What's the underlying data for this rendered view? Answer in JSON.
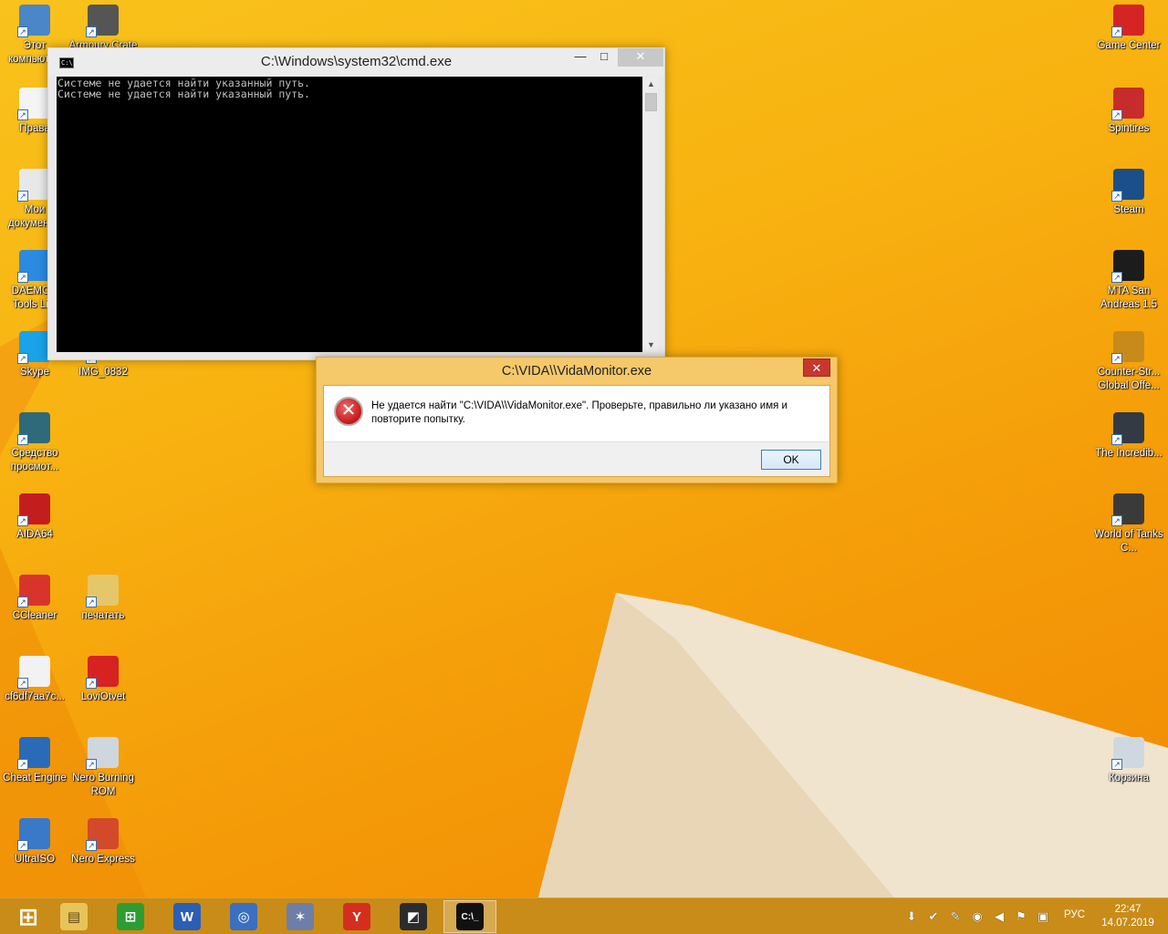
{
  "cmd_window": {
    "title": "C:\\Windows\\system32\\cmd.exe",
    "sys_icon_text": "C:\\.",
    "minimize": "—",
    "maximize": "□",
    "close": "✕",
    "console_lines": [
      "Системе не удается найти указанный путь.",
      "Системе не удается найти указанный путь."
    ],
    "scroll_up": "▲",
    "scroll_down": "▼"
  },
  "dialog": {
    "title": "C:\\VIDA\\\\VidaMonitor.exe",
    "close": "✕",
    "message": "Не удается найти \"C:\\VIDA\\\\VidaMonitor.exe\". Проверьте, правильно ли указано имя и повторите попытку.",
    "ok_label": "OK",
    "error_glyph": "✕"
  },
  "desktop_left": [
    {
      "label": "Этот компьютер",
      "icon": "computer-icon",
      "color": "#4a86c8"
    },
    {
      "label": "Armoury Crate",
      "icon": "armoury-icon",
      "color": "#555555"
    },
    {
      "label": "Права",
      "icon": "document-icon",
      "color": "#f4f4f4"
    },
    {
      "label": "Мои документы",
      "icon": "documents-icon",
      "color": "#e8e8e8"
    },
    {
      "label": "DAEMON Tools Lite",
      "icon": "daemon-tools-icon",
      "color": "#2b8be0"
    },
    {
      "label": "Skype",
      "icon": "skype-icon",
      "color": "#1aa3e8"
    },
    {
      "label": "IMG_0832",
      "icon": "image-icon",
      "color": "#f7b31a"
    },
    {
      "label": "Средство просмот...",
      "icon": "viewer-icon",
      "color": "#2e6a7a"
    },
    {
      "label": "AIDA64",
      "icon": "aida64-icon",
      "color": "#c41d1d"
    },
    {
      "label": "CCleaner",
      "icon": "ccleaner-icon",
      "color": "#d8342b"
    },
    {
      "label": "печатать",
      "icon": "folder-icon",
      "color": "#e6c66a"
    },
    {
      "label": "cf6df7aa7c...",
      "icon": "mp3-icon",
      "color": "#f2f2f2"
    },
    {
      "label": "LoviOtvet",
      "icon": "loviotvet-icon",
      "color": "#d72222"
    },
    {
      "label": "Cheat Engine",
      "icon": "cheat-engine-icon",
      "color": "#2a6bb8"
    },
    {
      "label": "Nero Burning ROM",
      "icon": "nero-icon",
      "color": "#cfd6de"
    },
    {
      "label": "UltraISO",
      "icon": "ultraiso-icon",
      "color": "#3a78c8"
    },
    {
      "label": "Nero Express",
      "icon": "nero-express-icon",
      "color": "#d24a2a"
    }
  ],
  "desktop_right": [
    {
      "label": "Game Center",
      "icon": "game-center-icon",
      "color": "#d42424"
    },
    {
      "label": "Spintires",
      "icon": "spintires-icon",
      "color": "#c72b2b"
    },
    {
      "label": "Steam",
      "icon": "steam-icon",
      "color": "#1b4f8a"
    },
    {
      "label": "MTA San Andreas 1.5",
      "icon": "mta-icon",
      "color": "#1c1c1c"
    },
    {
      "label": "Counter-Str... Global Offe...",
      "icon": "csgo-icon",
      "color": "#c98a1c"
    },
    {
      "label": "The Incredib...",
      "icon": "incredible-icon",
      "color": "#333a44"
    },
    {
      "label": "World of Tanks C...",
      "icon": "wot-icon",
      "color": "#3a3a3a"
    },
    {
      "label": "Корзина",
      "icon": "recycle-bin-icon",
      "color": "#cfd8e0"
    }
  ],
  "taskbar": {
    "apps": [
      {
        "name": "start",
        "icon": "windows-logo-icon",
        "glyph": "⊞",
        "color": "#ffffff",
        "active": false
      },
      {
        "name": "explorer",
        "icon": "file-explorer-icon",
        "glyph": "▤",
        "color": "#e8c35a",
        "active": false
      },
      {
        "name": "store",
        "icon": "store-icon",
        "glyph": "⊞",
        "color": "#2d9d33",
        "active": false
      },
      {
        "name": "word",
        "icon": "word-icon",
        "glyph": "W",
        "color": "#2b5fb4",
        "active": false
      },
      {
        "name": "torrent",
        "icon": "torrent-icon",
        "glyph": "◎",
        "color": "#3b6fc0",
        "active": false
      },
      {
        "name": "satellite",
        "icon": "satellite-icon",
        "glyph": "✶",
        "color": "#6d7fa8",
        "active": false
      },
      {
        "name": "yandex",
        "icon": "yandex-browser-icon",
        "glyph": "Y",
        "color": "#d62e1e",
        "active": false
      },
      {
        "name": "gpu-tool",
        "icon": "gpu-tool-icon",
        "glyph": "◩",
        "color": "#2c2c2c",
        "active": false
      },
      {
        "name": "cmd",
        "icon": "cmd-icon",
        "glyph": "C:\\_",
        "color": "#111111",
        "active": true
      }
    ],
    "tray_icons": [
      {
        "icon": "download-arrow-icon",
        "glyph": "⬇"
      },
      {
        "icon": "network-check-icon",
        "glyph": "✔"
      },
      {
        "icon": "tools-icon",
        "glyph": "✎"
      },
      {
        "icon": "game-center-tray-icon",
        "glyph": "◉"
      },
      {
        "icon": "volume-icon",
        "glyph": "◀"
      },
      {
        "icon": "flag-icon",
        "glyph": "⚑"
      },
      {
        "icon": "display-icon",
        "glyph": "▣"
      }
    ],
    "language": "РУС",
    "time": "22:47",
    "date": "14.07.2019"
  }
}
